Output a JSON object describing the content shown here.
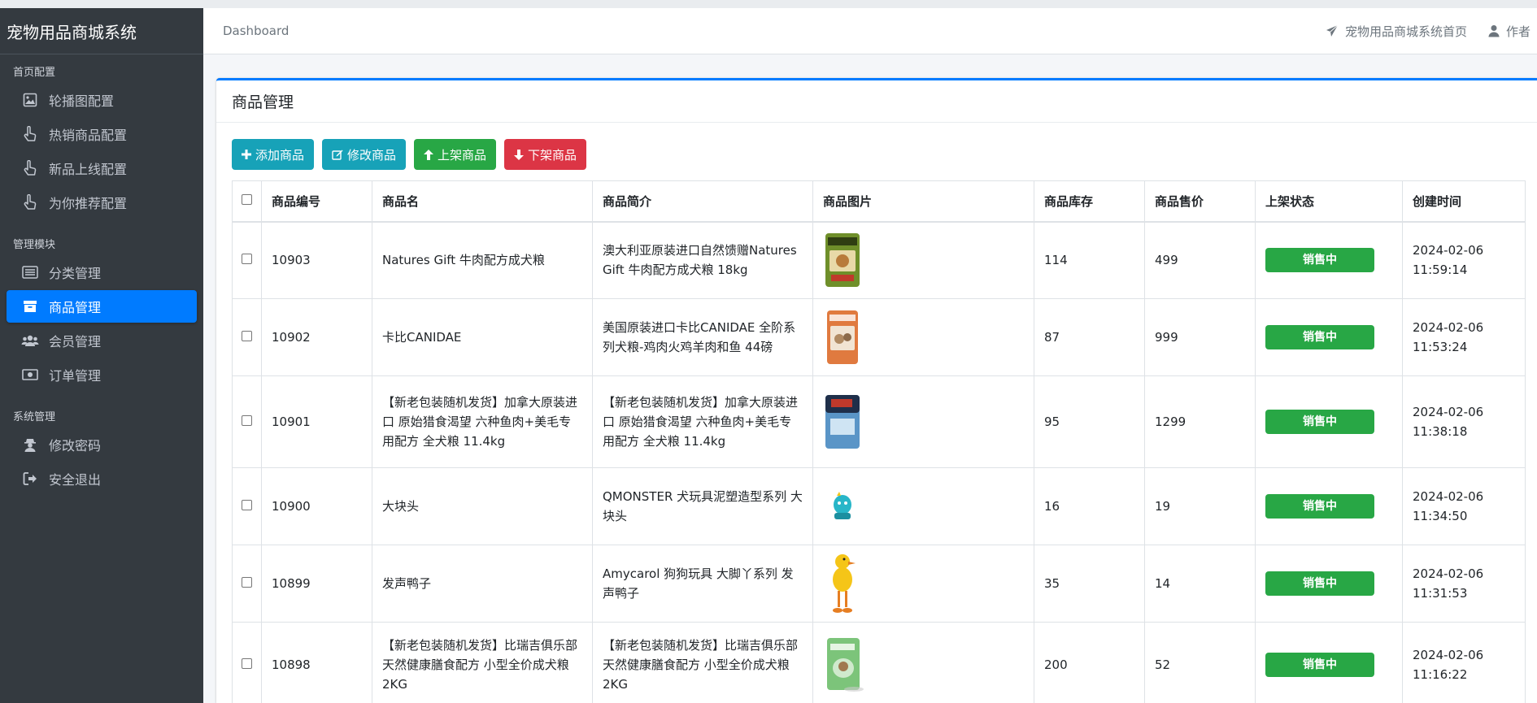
{
  "brand": "宠物用品商城系统",
  "sidebar": {
    "sections": [
      {
        "header": "首页配置",
        "items": [
          {
            "label": "轮播图配置",
            "icon": "image-icon"
          },
          {
            "label": "热销商品配置",
            "icon": "hand-pointer-icon"
          },
          {
            "label": "新品上线配置",
            "icon": "hand-pointer-icon"
          },
          {
            "label": "为你推荐配置",
            "icon": "hand-pointer-icon"
          }
        ]
      },
      {
        "header": "管理模块",
        "items": [
          {
            "label": "分类管理",
            "icon": "list-icon"
          },
          {
            "label": "商品管理",
            "icon": "archive-icon"
          },
          {
            "label": "会员管理",
            "icon": "users-icon"
          },
          {
            "label": "订单管理",
            "icon": "money-icon"
          }
        ]
      },
      {
        "header": "系统管理",
        "items": [
          {
            "label": "修改密码",
            "icon": "user-secret-icon"
          },
          {
            "label": "安全退出",
            "icon": "sign-out-icon"
          }
        ]
      }
    ],
    "active": "商品管理"
  },
  "header": {
    "breadcrumb": "Dashboard",
    "home_link": "宠物用品商城系统首页",
    "author_link": "作者"
  },
  "card": {
    "title": "商品管理",
    "buttons": {
      "add": "添加商品",
      "edit": "修改商品",
      "on_shelf": "上架商品",
      "off_shelf": "下架商品"
    }
  },
  "colors": {
    "sidebar_bg": "#343a40",
    "primary": "#007bff",
    "info": "#17a2b8",
    "success": "#28a745",
    "danger": "#dc3545"
  },
  "table": {
    "columns": [
      "商品编号",
      "商品名",
      "商品简介",
      "商品图片",
      "商品库存",
      "商品售价",
      "上架状态",
      "创建时间"
    ],
    "rows": [
      {
        "id": "10903",
        "name": "Natures Gift 牛肉配方成犬粮",
        "intro": "澳大利亚原装进口自然馈赠Natures Gift 牛肉配方成犬粮 18kg",
        "image": "dog-food-bag-green",
        "stock": "114",
        "price": "499",
        "status": "销售中",
        "created": "2024-02-06 11:59:14"
      },
      {
        "id": "10902",
        "name": "卡比CANIDAE",
        "intro": "美国原装进口卡比CANIDAE 全阶系列犬粮-鸡肉火鸡羊肉和鱼 44磅",
        "image": "dog-food-bag-orange",
        "stock": "87",
        "price": "999",
        "status": "销售中",
        "created": "2024-02-06 11:53:24"
      },
      {
        "id": "10901",
        "name": "【新老包装随机发货】加拿大原装进口 原始猎食渴望 六种鱼肉+美毛专用配方 全犬粮 11.4kg",
        "intro": "【新老包装随机发货】加拿大原装进口 原始猎食渴望 六种鱼肉+美毛专用配方 全犬粮 11.4kg",
        "image": "dog-food-bag-blue",
        "stock": "95",
        "price": "1299",
        "status": "销售中",
        "created": "2024-02-06 11:38:18"
      },
      {
        "id": "10900",
        "name": "大块头",
        "intro": "QMONSTER 犬玩具泥塑造型系列 大块头",
        "image": "dog-toy-figure",
        "stock": "16",
        "price": "19",
        "status": "销售中",
        "created": "2024-02-06 11:34:50"
      },
      {
        "id": "10899",
        "name": "发声鸭子",
        "intro": "Amycarol 狗狗玩具 大脚丫系列 发声鸭子",
        "image": "squeaky-duck-toy",
        "stock": "35",
        "price": "14",
        "status": "销售中",
        "created": "2024-02-06 11:31:53"
      },
      {
        "id": "10898",
        "name": "【新老包装随机发货】比瑞吉俱乐部 天然健康膳食配方 小型全价成犬粮 2KG",
        "intro": "【新老包装随机发货】比瑞吉俱乐部 天然健康膳食配方 小型全价成犬粮 2KG",
        "image": "dog-food-bag-lightgreen",
        "stock": "200",
        "price": "52",
        "status": "销售中",
        "created": "2024-02-06 11:16:22"
      }
    ]
  }
}
